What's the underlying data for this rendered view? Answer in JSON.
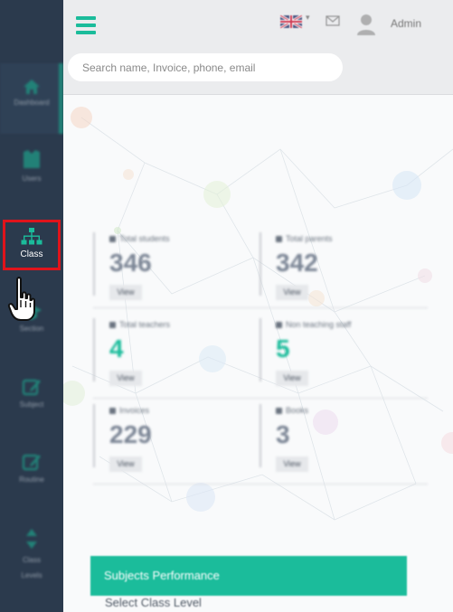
{
  "header": {
    "search_placeholder": "Search name, Invoice, phone, email",
    "user_name": "Admin"
  },
  "sidebar": {
    "items": [
      {
        "label": "Dashboard",
        "icon": "home-icon"
      },
      {
        "label": "Users",
        "icon": "users-icon"
      },
      {
        "label": "Class",
        "icon": "sitemap-icon"
      },
      {
        "label": "Section",
        "icon": "graduation-cap-icon"
      },
      {
        "label": "Subject",
        "icon": "edit-icon"
      },
      {
        "label": "Routine",
        "icon": "edit-icon"
      },
      {
        "label": "Class Levels",
        "icon": "sort-icon"
      }
    ]
  },
  "stats": [
    {
      "label": "Total students",
      "value": "346",
      "button": "View"
    },
    {
      "label": "Total parents",
      "value": "342",
      "button": "View"
    },
    {
      "label": "Total teachers",
      "value": "4",
      "button": "View"
    },
    {
      "label": "Non teaching staff",
      "value": "5",
      "button": "View"
    },
    {
      "label": "Invoices",
      "value": "229",
      "button": "View"
    },
    {
      "label": "Books",
      "value": "3",
      "button": "View"
    }
  ],
  "subjects_panel": {
    "title": "Subjects Performance",
    "select_label": "Select Class Level"
  },
  "colors": {
    "sidebar_bg": "#2b3a4d",
    "accent": "#1bbc9b",
    "highlight_border": "#e0141b",
    "header_bg": "#ebecee"
  }
}
